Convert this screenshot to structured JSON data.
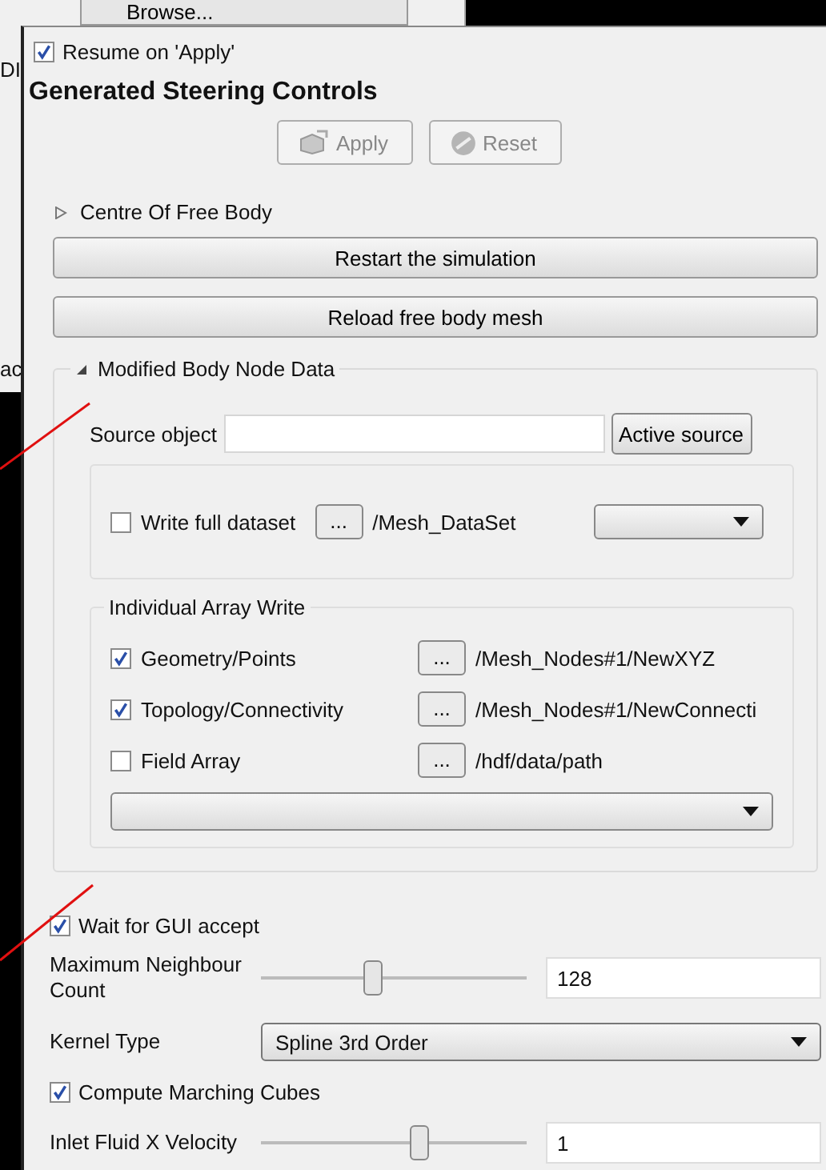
{
  "background_window": {
    "button": "Browse...",
    "texts": [
      "DI",
      "ac"
    ]
  },
  "resume": {
    "label": "Resume on 'Apply'",
    "checked": true
  },
  "title": "Generated Steering Controls",
  "toolbar_buttons": [
    {
      "label": "Apply",
      "disabled": true,
      "kind": "apply"
    },
    {
      "label": "Reset",
      "disabled": true,
      "kind": "reset"
    }
  ],
  "centre_section": {
    "label": "Centre Of Free Body",
    "expanded": false
  },
  "action_buttons": [
    "Restart the simulation",
    "Reload free body mesh"
  ],
  "modified_section": {
    "label": "Modified Body Node Data",
    "expanded": true,
    "source_label": "Source object",
    "source_button": "Active source",
    "full_dataset": {
      "label": "Write full dataset",
      "checked": false,
      "browse": "...",
      "path": "/Mesh_DataSet"
    },
    "array_group": {
      "title": "Individual Array Write",
      "rows": [
        {
          "label": "Geometry/Points",
          "checked": true,
          "browse": "...",
          "path": "/Mesh_Nodes#1/NewXYZ"
        },
        {
          "label": "Topology/Connectivity",
          "checked": true,
          "browse": "...",
          "path": "/Mesh_Nodes#1/NewConnecti"
        },
        {
          "label": "Field Array",
          "checked": false,
          "browse": "...",
          "path": "/hdf/data/path"
        }
      ]
    }
  },
  "controls": [
    {
      "kind": "checkbox",
      "label": "Wait for GUI accept",
      "checked": true
    },
    {
      "kind": "slider",
      "label": "Maximum Neighbour Count",
      "level": 0.43,
      "value": "128"
    },
    {
      "kind": "dropdown",
      "label": "Kernel Type",
      "value": "Spline 3rd Order"
    },
    {
      "kind": "checkbox",
      "label": "Compute Marching Cubes",
      "checked": true
    },
    {
      "kind": "slider",
      "label": "Inlet Fluid X Velocity",
      "level": 0.6,
      "value": "1"
    }
  ]
}
